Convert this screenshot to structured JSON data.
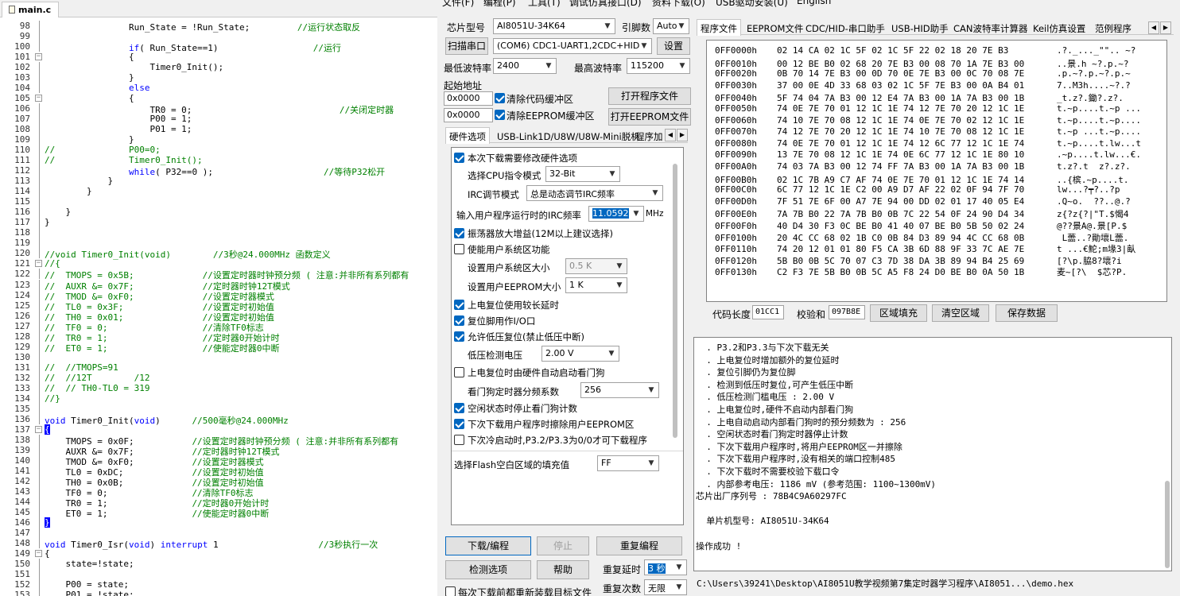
{
  "editor": {
    "tab_label": "main.c",
    "lines": [
      {
        "n": "98",
        "code": [
          [
            "",
            "                Run_State = !Run_State;         "
          ],
          [
            "cm",
            "//运行状态取反"
          ]
        ]
      },
      {
        "n": "99",
        "code": []
      },
      {
        "n": "100",
        "code": [
          [
            "",
            "                "
          ],
          [
            "kw",
            "if"
          ],
          [
            "",
            "( Run_State==1)                  "
          ],
          [
            "cm",
            "//运行"
          ]
        ]
      },
      {
        "n": "101",
        "code": [
          [
            "",
            "                {"
          ]
        ]
      },
      {
        "n": "102",
        "code": [
          [
            "",
            "                    Timer0_Init();"
          ]
        ]
      },
      {
        "n": "103",
        "code": [
          [
            "",
            "                }"
          ]
        ]
      },
      {
        "n": "104",
        "code": [
          [
            "",
            "                "
          ],
          [
            "kw",
            "else"
          ]
        ]
      },
      {
        "n": "105",
        "code": [
          [
            "",
            "                {"
          ]
        ]
      },
      {
        "n": "106",
        "code": [
          [
            "",
            "                    TR0 = 0;                            "
          ],
          [
            "cm",
            "//关闭定时器"
          ]
        ]
      },
      {
        "n": "107",
        "code": [
          [
            "",
            "                    P00 = 1;"
          ]
        ]
      },
      {
        "n": "108",
        "code": [
          [
            "",
            "                    P01 = 1;"
          ]
        ]
      },
      {
        "n": "109",
        "code": [
          [
            "",
            "                }"
          ]
        ]
      },
      {
        "n": "110",
        "code": [
          [
            "cm",
            "//              P00=0;"
          ]
        ]
      },
      {
        "n": "111",
        "code": [
          [
            "cm",
            "//              Timer0_Init();"
          ]
        ]
      },
      {
        "n": "112",
        "code": [
          [
            "",
            "                "
          ],
          [
            "kw",
            "while"
          ],
          [
            "",
            "( P32==0 );                     "
          ],
          [
            "cm",
            "//等待P32松开"
          ]
        ]
      },
      {
        "n": "113",
        "code": [
          [
            "",
            "            }"
          ]
        ]
      },
      {
        "n": "114",
        "code": [
          [
            "",
            "        }"
          ]
        ]
      },
      {
        "n": "115",
        "code": []
      },
      {
        "n": "116",
        "code": [
          [
            "",
            "    }"
          ]
        ]
      },
      {
        "n": "117",
        "code": [
          [
            "",
            "}"
          ]
        ]
      },
      {
        "n": "118",
        "code": []
      },
      {
        "n": "119",
        "code": []
      },
      {
        "n": "120",
        "code": [
          [
            "cm",
            "//void Timer0_Init(void)        //3秒@24.000MHz 函数定义"
          ]
        ]
      },
      {
        "n": "121",
        "code": [
          [
            "cm",
            "//{"
          ]
        ]
      },
      {
        "n": "122",
        "code": [
          [
            "cm",
            "//  TMOPS = 0x5B;             //设置定时器时钟预分频 ( 注意:并非所有系列都有"
          ]
        ]
      },
      {
        "n": "123",
        "code": [
          [
            "cm",
            "//  AUXR &= 0x7F;             //定时器时钟12T模式"
          ]
        ]
      },
      {
        "n": "124",
        "code": [
          [
            "cm",
            "//  TMOD &= 0xF0;             //设置定时器模式"
          ]
        ]
      },
      {
        "n": "125",
        "code": [
          [
            "cm",
            "//  TL0 = 0x3F;               //设置定时初始值"
          ]
        ]
      },
      {
        "n": "126",
        "code": [
          [
            "cm",
            "//  TH0 = 0x01;               //设置定时初始值"
          ]
        ]
      },
      {
        "n": "127",
        "code": [
          [
            "cm",
            "//  TF0 = 0;                  //清除TF0标志"
          ]
        ]
      },
      {
        "n": "128",
        "code": [
          [
            "cm",
            "//  TR0 = 1;                  //定时器0开始计时"
          ]
        ]
      },
      {
        "n": "129",
        "code": [
          [
            "cm",
            "//  ET0 = 1;                  //使能定时器0中断"
          ]
        ]
      },
      {
        "n": "130",
        "code": []
      },
      {
        "n": "131",
        "code": [
          [
            "cm",
            "//  //TMOPS=91"
          ]
        ]
      },
      {
        "n": "132",
        "code": [
          [
            "cm",
            "//  //12T        /12"
          ]
        ]
      },
      {
        "n": "133",
        "code": [
          [
            "cm",
            "//  // TH0-TL0 = 319"
          ]
        ]
      },
      {
        "n": "134",
        "code": [
          [
            "cm",
            "//}"
          ]
        ]
      },
      {
        "n": "135",
        "code": []
      },
      {
        "n": "136",
        "code": [
          [
            "kw",
            "void"
          ],
          [
            "",
            " Timer0_Init("
          ],
          [
            "kw",
            "void"
          ],
          [
            "",
            ")      "
          ],
          [
            "cm",
            "//500毫秒@24.000MHz"
          ]
        ]
      },
      {
        "n": "137",
        "code": [
          [
            "br",
            "{"
          ]
        ]
      },
      {
        "n": "138",
        "code": [
          [
            "",
            "    TMOPS = 0x0F;           "
          ],
          [
            "cm",
            "//设置定时器时钟预分频 ( 注意:并非所有系列都有"
          ]
        ]
      },
      {
        "n": "139",
        "code": [
          [
            "",
            "    AUXR &= 0x7F;           "
          ],
          [
            "cm",
            "//定时器时钟12T模式"
          ]
        ]
      },
      {
        "n": "140",
        "code": [
          [
            "",
            "    TMOD &= 0xF0;           "
          ],
          [
            "cm",
            "//设置定时器模式"
          ]
        ]
      },
      {
        "n": "141",
        "code": [
          [
            "",
            "    TL0 = 0xDC;             "
          ],
          [
            "cm",
            "//设置定时初始值"
          ]
        ]
      },
      {
        "n": "142",
        "code": [
          [
            "",
            "    TH0 = 0x0B;             "
          ],
          [
            "cm",
            "//设置定时初始值"
          ]
        ]
      },
      {
        "n": "143",
        "code": [
          [
            "",
            "    TF0 = 0;                "
          ],
          [
            "cm",
            "//清除TF0标志"
          ]
        ]
      },
      {
        "n": "144",
        "code": [
          [
            "",
            "    TR0 = 1;                "
          ],
          [
            "cm",
            "//定时器0开始计时"
          ]
        ]
      },
      {
        "n": "145",
        "code": [
          [
            "",
            "    ET0 = 1;                "
          ],
          [
            "cm",
            "//使能定时器0中断"
          ]
        ]
      },
      {
        "n": "146",
        "code": [
          [
            "br",
            "}"
          ]
        ]
      },
      {
        "n": "147",
        "code": []
      },
      {
        "n": "148",
        "code": [
          [
            "kw",
            "void"
          ],
          [
            "",
            " Timer0_Isr("
          ],
          [
            "kw",
            "void"
          ],
          [
            "",
            ") "
          ],
          [
            "kw",
            "interrupt"
          ],
          [
            "",
            " 1                   "
          ],
          [
            "cm",
            "//3秒执行一次"
          ]
        ]
      },
      {
        "n": "149",
        "code": [
          [
            "",
            "{"
          ]
        ]
      },
      {
        "n": "150",
        "code": [
          [
            "",
            "    state=!state;"
          ]
        ]
      },
      {
        "n": "151",
        "code": []
      },
      {
        "n": "152",
        "code": [
          [
            "",
            "    P00 = state;"
          ]
        ]
      },
      {
        "n": "153",
        "code": [
          [
            "",
            "    P01 = !state;"
          ]
        ]
      }
    ]
  },
  "menu": [
    "文件(F)",
    "编程(P)",
    "工具(T)",
    "调试仿真接口(D)",
    "资料下载(O)",
    "USB驱动安装(U)",
    "English"
  ],
  "left": {
    "chip_label": "芯片型号",
    "chip_value": "AI8051U-34K64",
    "pins_label": "引脚数",
    "pins_value": "Auto",
    "scan_button": "扫描串口",
    "port_value": "(COM6) CDC1-UART1,2CDC+HID",
    "settings_button": "设置",
    "min_baud_label": "最低波特率",
    "min_baud_value": "2400",
    "max_baud_label": "最高波特率",
    "max_baud_value": "115200",
    "start_addr_label": "起始地址",
    "addr1": "0x0000",
    "clear_code_label": "清除代码缓冲区",
    "open_prog_button": "打开程序文件",
    "addr2": "0x0000",
    "clear_eeprom_label": "清除EEPROM缓冲区",
    "open_eeprom_button": "打开EEPROM文件",
    "tabs": [
      "硬件选项",
      "USB-Link1D/U8W/U8W-Mini脱机",
      "程序加"
    ]
  },
  "hw": {
    "opt1": "本次下载需要修改硬件选项",
    "cpu_mode_label": "选择CPU指令模式",
    "cpu_mode_value": "32-Bit",
    "irc_mode_label": "IRC调节模式",
    "irc_mode_value": "总是动态调节IRC频率",
    "irc_freq_label": "输入用户程序运行时的IRC频率",
    "irc_freq_value": "11.0592",
    "irc_freq_unit": "MHz",
    "osc_gain": "振荡器放大增益(12M以上建议选择)",
    "user_sys_area": "使能用户系统区功能",
    "user_sys_size_label": "设置用户系统区大小",
    "user_sys_size_value": "0.5 K",
    "user_eeprom_label": "设置用户EEPROM大小",
    "user_eeprom_value": "1   K",
    "reset_delay": "上电复位使用较长延时",
    "reset_pin_io": "复位脚用作I/O口",
    "lvd_reset": "允许低压复位(禁止低压中断)",
    "lvd_voltage_label": "低压检测电压",
    "lvd_voltage_value": "2.00 V",
    "wdt_auto": "上电复位时由硬件自动启动看门狗",
    "wdt_div_label": "看门狗定时器分频系数",
    "wdt_div_value": "256",
    "idle_wdt_stop": "空闲状态时停止看门狗计数",
    "erase_eeprom": "下次下载用户程序时擦除用户EEPROM区",
    "p32_p33": "下次冷启动时,P3.2/P3.3为0/0才可下载程序",
    "fill_label": "选择Flash空白区域的填充值",
    "fill_value": "FF"
  },
  "actions": {
    "download": "下载/编程",
    "stop": "停止",
    "reprogram": "重复编程",
    "check": "检测选项",
    "help": "帮助",
    "repeat_delay_label": "重复延时",
    "repeat_delay_value": "3 秒",
    "reload_label": "每次下载前都重新装载目标文件",
    "repeat_count_label": "重复次数",
    "repeat_count_value": "无限"
  },
  "right_tabs": [
    "程序文件",
    "EEPROM文件",
    "CDC/HID-串口助手",
    "USB-HID助手",
    "CAN波特率计算器",
    "Keil仿真设置",
    "范例程序"
  ],
  "hex": {
    "rows": [
      [
        "0FF0000h",
        "02 14 CA 02 1C 5F 02 1C 5F 22 02 18 20 7E B3",
        ".?._..._\"\".. ~?"
      ],
      [
        "0FF0010h",
        "00 12 BE B0 02 68 20 7E B3 00 08 70 1A 7E B3 00",
        "..景.h ~?.p.~?"
      ],
      [
        "0FF0020h",
        "0B 70 14 7E B3 00 0D 70 0E 7E B3 00 0C 70 08 7E",
        ".p.~?.p.~?.p.~"
      ],
      [
        "0FF0030h",
        "37 00 0E 4D 33 68 03 02 1C 5F 7E B3 00 0A B4 01",
        "7..M3h....~?.?"
      ],
      [
        "0FF0040h",
        "5F 74 04 7A B3 00 12 E4 7A B3 00 1A 7A B3 00 1B",
        "_t.z?.鋤?.z?."
      ],
      [
        "0FF0050h",
        "74 0E 7E 70 01 12 1C 1E 74 12 7E 70 20 12 1C 1E",
        "t.~p....t.~p ..."
      ],
      [
        "0FF0060h",
        "74 10 7E 70 08 12 1C 1E 74 0E 7E 70 02 12 1C 1E",
        "t.~p....t.~p...."
      ],
      [
        "0FF0070h",
        "74 12 7E 70 20 12 1C 1E 74 10 7E 70 08 12 1C 1E",
        "t.~p ...t.~p...."
      ],
      [
        "0FF0080h",
        "74 0E 7E 70 01 12 1C 1E 74 12 6C 77 12 1C 1E 74",
        "t.~p....t.lw...t"
      ],
      [
        "0FF0090h",
        "13 7E 70 08 12 1C 1E 74 0E 6C 77 12 1C 1E 80 10",
        ".~p....t.lw...€."
      ],
      [
        "0FF00A0h",
        "74 03 7A B3 00 12 74 FF 7A B3 00 1A 7A B3 00 1B",
        "t.z?.t  z?.z?."
      ],
      [
        "0FF00B0h",
        "02 1C 7B A9 C7 AF 74 0E 7E 70 01 12 1C 1E 74 14",
        "..{槟.~p....t."
      ],
      [
        "0FF00C0h",
        "6C 77 12 1C 1E C2 00 A9 D7 AF 22 02 0F 94 7F 70",
        "lw...?┯?..?p"
      ],
      [
        "0FF00D0h",
        "7F 51 7E 6F 00 A7 7E 94 00 DD 02 01 17 40 05 E4",
        ".Q~o.  ??..@.?"
      ],
      [
        "0FF00E0h",
        "7A 7B B0 22 7A 7B B0 0B 7C 22 54 0F 24 90 D4 34",
        "z{?z{?|\"T.$愒4"
      ],
      [
        "0FF00F0h",
        "40 D4 30 F3 0C BE B0 41 40 07 BE B0 5B 50 02 24",
        "@??景A@.景[P.$"
      ],
      [
        "0FF0100h",
        "20 4C CC 68 02 1B C0 0B 84 D3 89 94 4C CC 68 0B",
        " L蘦..?勛壞L蘦."
      ],
      [
        "0FF0110h",
        "74 20 12 01 01 80 F5 CA 3B 6D 88 9F 33 7C AE 7E",
        "t ...€鮀;m堟3|畒"
      ],
      [
        "0FF0120h",
        "5B B0 0B 5C 70 07 C3 7D 38 DA 3B 89 94 B4 25 69",
        "[?\\p.脇8?壞?i"
      ],
      [
        "0FF0130h",
        "C2 F3 7E 5B B0 0B 5C A5 F8 24 D0 BE B0 0A 50 1B",
        "麦~[?\\  $芯?P."
      ]
    ],
    "code_len_label": "代码长度",
    "code_len_value": "01CC1",
    "checksum_label": "校验和",
    "checksum_value": "097B8E",
    "fill_button": "区域填充",
    "clear_button": "清空区域",
    "save_button": "保存数据"
  },
  "log": [
    "  . P3.2和P3.3与下次下载无关",
    "  . 上电复位时增加额外的复位延时",
    "  . 复位引脚仍为复位脚",
    "  . 检测到低压时复位,可产生低压中断",
    "  . 低压检测门槛电压 : 2.00 V",
    "  . 上电复位时,硬件不启动内部看门狗",
    "  . 上电自动启动内部看门狗时的预分频数为 : 256",
    "  . 空闲状态时看门狗定时器停止计数",
    "  . 下次下载用户程序时,将用户EEPROM区一并擦除",
    "  . 下次下载用户程序时,没有相关的端口控制485",
    "  . 下次下载时不需要校验下载口令",
    "  . 内部参考电压: 1186 mV (参考范围: 1100~1300mV)",
    "芯片出厂序列号 : 78B4C9A60297FC",
    "",
    "  单片机型号: AI8051U-34K64",
    "",
    "操作成功 !"
  ],
  "status_path": "C:\\Users\\39241\\Desktop\\AI8051U教学视频第7集定时器学习程序\\AI8051...\\demo.hex"
}
